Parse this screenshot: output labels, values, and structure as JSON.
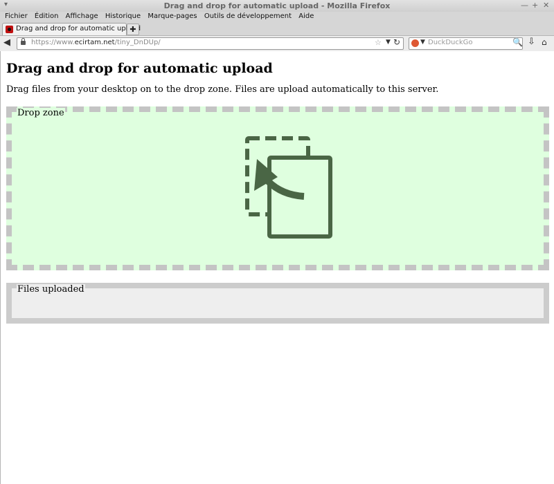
{
  "window": {
    "title": "Drag and drop for automatic upload - Mozilla Firefox",
    "menu_glyph": "▾",
    "minimize_glyph": "—",
    "maximize_glyph": "+",
    "close_glyph": "✕"
  },
  "menubar": {
    "items": [
      "Fichier",
      "Édition",
      "Affichage",
      "Historique",
      "Marque-pages",
      "Outils de développement",
      "Aide"
    ]
  },
  "tabs": [
    {
      "label": "Drag and drop for automatic upload",
      "active": true
    }
  ],
  "new_tab_glyph": "✚",
  "navbar": {
    "url_prefix": "https://www.",
    "url_host": "ecirtam.net",
    "url_path": "/tiny_DnDUp/",
    "search_placeholder": "DuckDuckGo",
    "back_glyph": "◀",
    "star_glyph": "☆",
    "dropdown_glyph": "▼",
    "reload_glyph": "↻",
    "search_glyph": "🔍",
    "download_glyph": "⇩",
    "home_glyph": "⌂"
  },
  "page": {
    "heading": "Drag and drop for automatic upload",
    "intro": "Drag files from your desktop on to the drop zone. Files are upload automatically to this server.",
    "dropzone_legend": "Drop zone",
    "uploaded_legend": "Files uploaded"
  },
  "colors": {
    "dropzone_bg": "#dfffdf",
    "dropzone_border": "#c4c4c4",
    "icon": "#4a6645",
    "uploaded_bg": "#eeeeee",
    "uploaded_border": "#cccccc"
  },
  "icons": {
    "dropzone": "drag-drop-file-icon",
    "favicon": "site-favicon",
    "search_engine": "duckduckgo-icon",
    "lock": "lock-icon"
  }
}
